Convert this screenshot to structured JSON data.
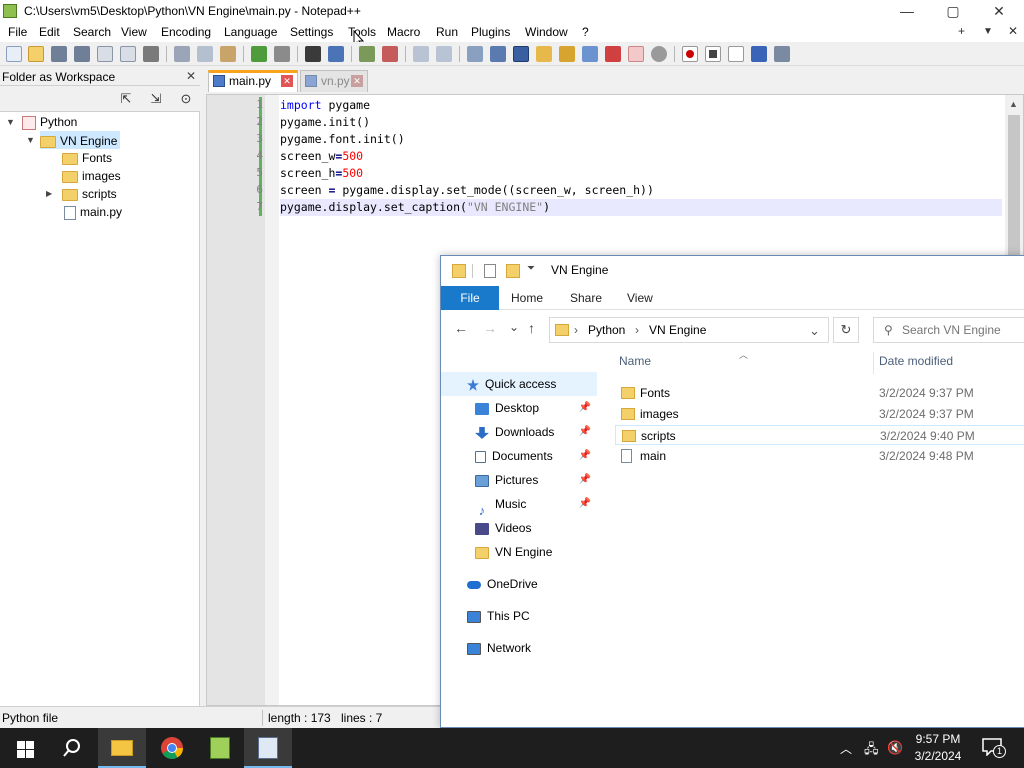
{
  "npp": {
    "title": "C:\\Users\\vm5\\Desktop\\Python\\VN Engine\\main.py - Notepad++",
    "window_buttons": {
      "minimize": "—",
      "maximize": "▢",
      "close": "✕"
    },
    "menus": [
      "File",
      "Edit",
      "Search",
      "View",
      "Encoding",
      "Language",
      "Settings",
      "Tools",
      "Macro",
      "Run",
      "Plugins",
      "Window",
      "?"
    ],
    "menu_right": {
      "plus": "+",
      "down": "▼",
      "close": "✕"
    },
    "workspace": {
      "title": "Folder as Workspace",
      "close": "✕",
      "tools": {
        "collapse": "⇱",
        "expand": "⇲",
        "locate": "⊙"
      },
      "tree": [
        "Python",
        "VN Engine",
        "Fonts",
        "images",
        "scripts",
        "main.py"
      ]
    },
    "tabs": [
      {
        "label": "main.py",
        "close": "✕"
      },
      {
        "label": "vn.py",
        "close": "✕"
      }
    ],
    "line_numbers": [
      "1",
      "2",
      "3",
      "4",
      "5",
      "6",
      "7"
    ],
    "code": {
      "l1_kw": "import",
      "l1_rest": " pygame",
      "l2": "pygame.init()",
      "l3": "pygame.font.init()",
      "l4_a": "screen_w",
      "l4_op": "=",
      "l4_num": "500",
      "l5_a": "screen_h",
      "l5_op": "=",
      "l5_num": "500",
      "l6_a": "screen ",
      "l6_op": "=",
      "l6_b": " pygame.display.set_mode((screen_w, screen_h))",
      "l7_a": "pygame.display.set_caption(",
      "l7_str": "\"VN ENGINE\"",
      "l7_b": ")"
    },
    "status": {
      "type": "Python file",
      "length": "length : 173",
      "lines": "lines : 7"
    }
  },
  "explorer": {
    "title": "VN Engine",
    "ribbon": [
      "File",
      "Home",
      "Share",
      "View"
    ],
    "nav": {
      "back": "←",
      "forward": "→",
      "recent": "⌄",
      "up": "↑",
      "refresh": "↻",
      "addr_dropdown": "⌄"
    },
    "breadcrumb": [
      "Python",
      "VN Engine"
    ],
    "breadcrumb_sep": "›",
    "search_placeholder": "Search VN Engine",
    "nav_items": [
      "Quick access",
      "Desktop",
      "Downloads",
      "Documents",
      "Pictures",
      "Music",
      "Videos",
      "VN Engine",
      "OneDrive",
      "This PC",
      "Network"
    ],
    "columns": {
      "name": "Name",
      "date": "Date modified"
    },
    "files": [
      {
        "name": "Fonts",
        "date": "3/2/2024 9:37 PM"
      },
      {
        "name": "images",
        "date": "3/2/2024 9:37 PM"
      },
      {
        "name": "scripts",
        "date": "3/2/2024 9:40 PM"
      },
      {
        "name": "main",
        "date": "3/2/2024 9:48 PM"
      }
    ]
  },
  "taskbar": {
    "time": "9:57 PM",
    "date": "3/2/2024",
    "notification_count": "1"
  }
}
